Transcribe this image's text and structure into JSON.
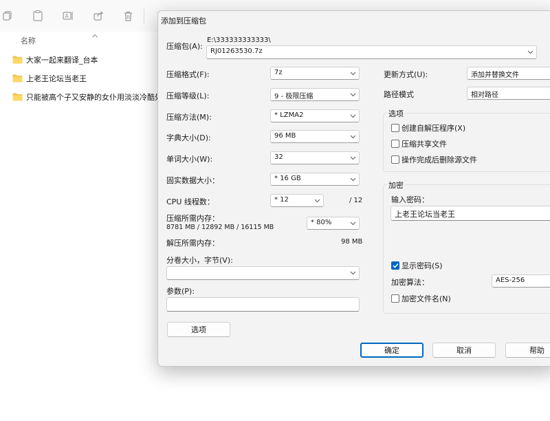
{
  "explorer": {
    "column_name": "名称",
    "files": [
      {
        "name": "大家一起来翻译_台本"
      },
      {
        "name": "上老王论坛当老王"
      },
      {
        "name": "只能被高个子又安静的女仆用淡淡冷酷处"
      }
    ],
    "colors": {
      "folder": "#f2c14e",
      "icon": "#9a9a9a"
    }
  },
  "dialog": {
    "title": "添加到压缩包",
    "archive": {
      "label": "压缩包(A):",
      "path": "E:\\333333333333\\",
      "filename": "RJ01263530.7z"
    },
    "left": {
      "format": {
        "label": "压缩格式(F):",
        "value": "7z"
      },
      "level": {
        "label": "压缩等级(L):",
        "value": "9 - 极限压缩"
      },
      "method": {
        "label": "压缩方法(M):",
        "value": "* LZMA2"
      },
      "dict": {
        "label": "字典大小(D):",
        "value": "96 MB"
      },
      "word": {
        "label": "单词大小(W):",
        "value": "32"
      },
      "solid": {
        "label": "固实数据大小：",
        "value": "* 16 GB"
      },
      "cpu": {
        "label": "CPU 线程数：",
        "value": "* 12",
        "max": "/ 12"
      },
      "mem_compress": {
        "label": "压缩所需内存：",
        "detail": "8781 MB / 12892 MB / 16115 MB",
        "value": "* 80%"
      },
      "mem_decompress": {
        "label": "解压所需内存：",
        "value": "98 MB"
      },
      "split": {
        "label": "分卷大小，字节(V):",
        "value": ""
      },
      "params": {
        "label": "参数(P):",
        "value": ""
      },
      "options_button": "选项"
    },
    "right": {
      "update": {
        "label": "更新方式(U):",
        "value": "添加并替换文件"
      },
      "pathmode": {
        "label": "路径模式",
        "value": "相对路径"
      },
      "options": {
        "title": "选项",
        "sfx": {
          "label": "创建自解压程序(X)",
          "checked": false
        },
        "shared": {
          "label": "压缩共享文件",
          "checked": false
        },
        "delete": {
          "label": "操作完成后删除源文件",
          "checked": false
        }
      },
      "encryption": {
        "title": "加密",
        "password_label": "输入密码：",
        "password": "上老王论坛当老王",
        "show_password": {
          "label": "显示密码(S)",
          "checked": true
        },
        "method_label": "加密算法：",
        "method": "AES-256",
        "encrypt_names": {
          "label": "加密文件名(N)",
          "checked": false
        }
      }
    },
    "buttons": {
      "ok": "确定",
      "cancel": "取消",
      "help": "帮助"
    },
    "colors": {
      "accent": "#0067c0"
    }
  }
}
